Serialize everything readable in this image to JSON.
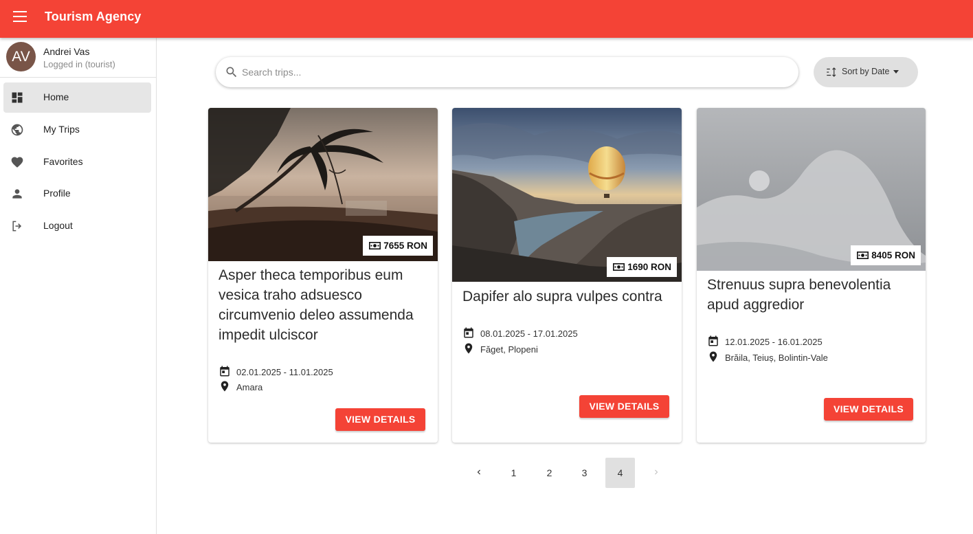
{
  "app": {
    "title": "Tourism Agency",
    "accent_color": "#f44336"
  },
  "user": {
    "initials": "AV",
    "name": "Andrei Vas",
    "status": "Logged in (tourist)"
  },
  "nav": {
    "items": [
      {
        "label": "Home",
        "icon": "dashboard-icon",
        "active": true
      },
      {
        "label": "My Trips",
        "icon": "globe-icon",
        "active": false
      },
      {
        "label": "Favorites",
        "icon": "heart-icon",
        "active": false
      },
      {
        "label": "Profile",
        "icon": "person-icon",
        "active": false
      },
      {
        "label": "Logout",
        "icon": "logout-icon",
        "active": false
      }
    ]
  },
  "search": {
    "placeholder": "Search trips...",
    "value": ""
  },
  "sort": {
    "label": "Sort by Date"
  },
  "trips": [
    {
      "title": "Asper theca temporibus eum vesica traho adsuesco circumvenio deleo assumenda impedit ulciscor",
      "price": "7655 RON",
      "dates": "02.01.2025 - 11.01.2025",
      "location": "Amara",
      "image": "beach-palm-sunset-photo",
      "button": "VIEW DETAILS"
    },
    {
      "title": "Dapifer alo supra vulpes contra",
      "price": "1690 RON",
      "dates": "08.01.2025 - 17.01.2025",
      "location": "Făget, Plopeni",
      "image": "canyon-balloon-photo",
      "button": "VIEW DETAILS"
    },
    {
      "title": "Strenuus supra benevolentia apud aggredior",
      "price": "8405 RON",
      "dates": "12.01.2025 - 16.01.2025",
      "location": "Brăila, Teiuș, Bolintin-Vale",
      "image": "placeholder-image",
      "button": "VIEW DETAILS"
    }
  ],
  "pagination": {
    "pages": [
      "1",
      "2",
      "3",
      "4"
    ],
    "current": "4"
  }
}
